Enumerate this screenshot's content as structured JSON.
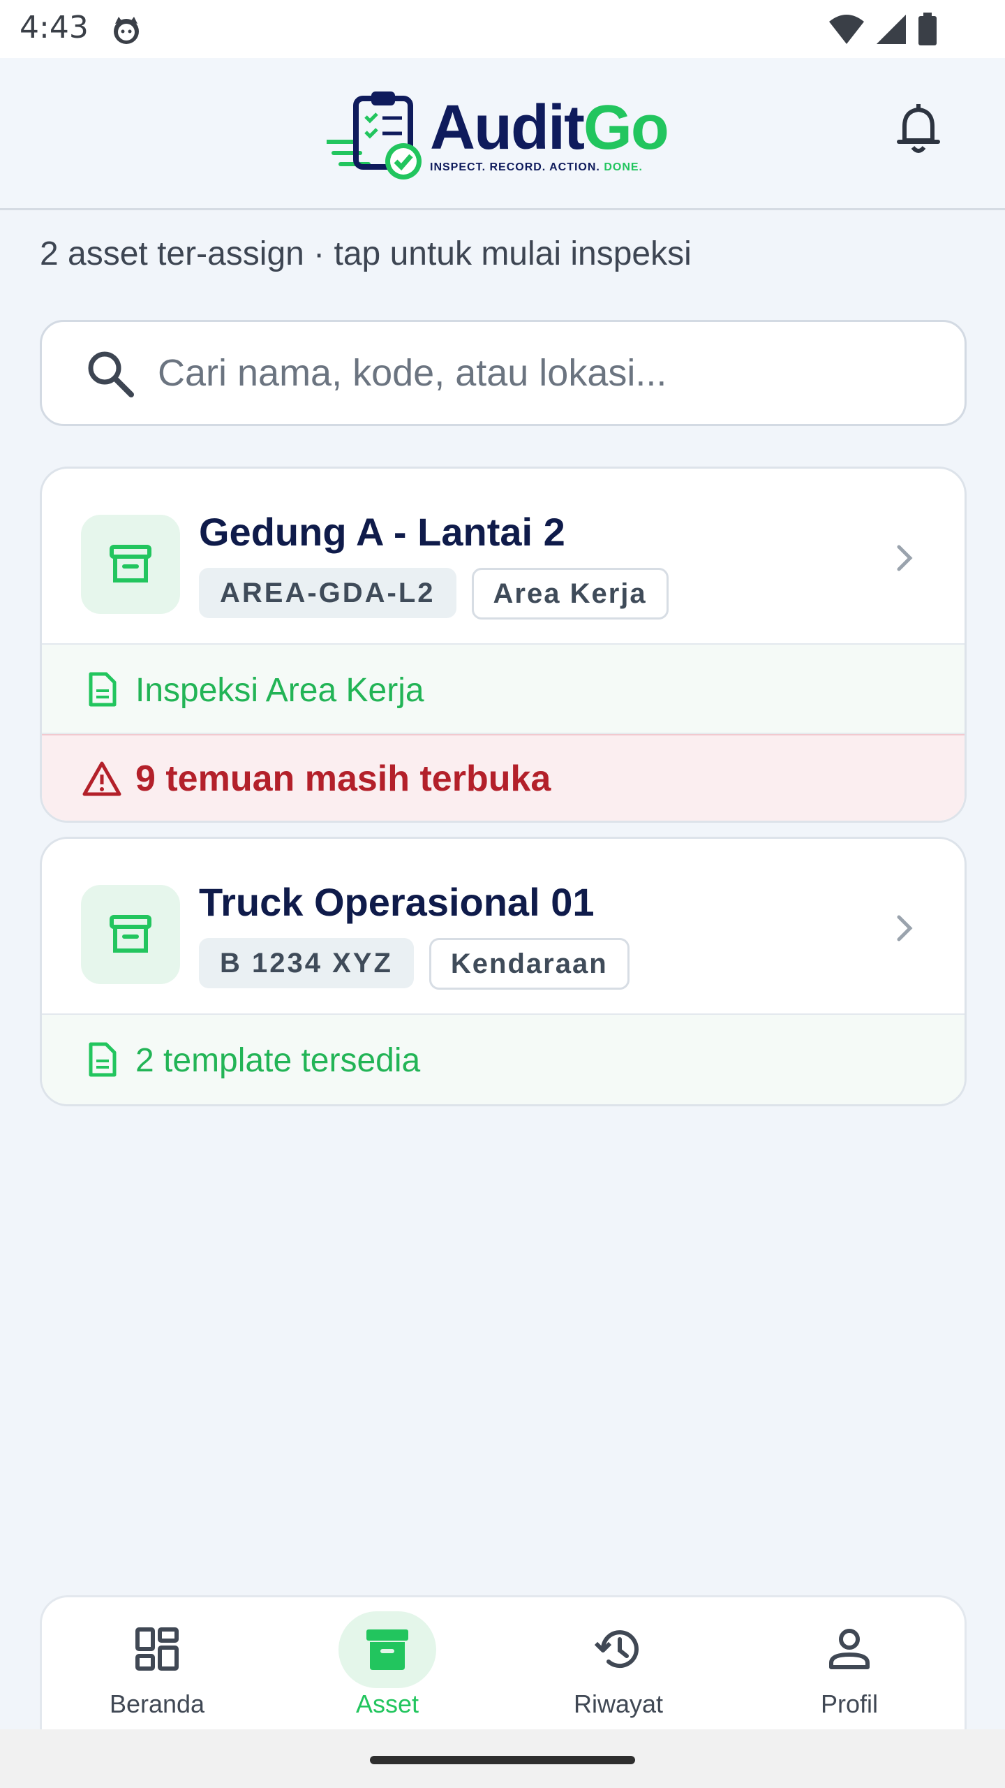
{
  "status_bar": {
    "time": "4:43",
    "icons": [
      "cat-app-icon",
      "wifi-icon",
      "signal-icon",
      "battery-icon"
    ]
  },
  "header": {
    "logo": {
      "word_primary": "Audit",
      "word_accent": "Go",
      "tagline_main": "INSPECT. RECORD. ACTION.",
      "tagline_accent": "DONE."
    },
    "notification_icon": "bell-icon"
  },
  "subtitle": "2 asset ter-assign · tap untuk mulai inspeksi",
  "search": {
    "placeholder": "Cari nama, kode, atau lokasi...",
    "value": ""
  },
  "assets": [
    {
      "name": "Gedung A - Lantai 2",
      "code": "AREA-GDA-L2",
      "type": "Area Kerja",
      "template": "Inspeksi Area Kerja",
      "alert": "9 temuan masih terbuka"
    },
    {
      "name": "Truck Operasional 01",
      "code": "B 1234 XYZ",
      "type": "Kendaraan",
      "template": "2 template tersedia"
    }
  ],
  "bottom_nav": [
    {
      "label": "Beranda",
      "icon": "dashboard-icon"
    },
    {
      "label": "Asset",
      "icon": "archive-icon",
      "active": true
    },
    {
      "label": "Riwayat",
      "icon": "history-icon"
    },
    {
      "label": "Profil",
      "icon": "person-icon"
    }
  ],
  "colors": {
    "brand_navy": "#0f1b5c",
    "brand_green": "#22c55e",
    "alert_red": "#b3202a",
    "background": "#f1f5fa"
  }
}
